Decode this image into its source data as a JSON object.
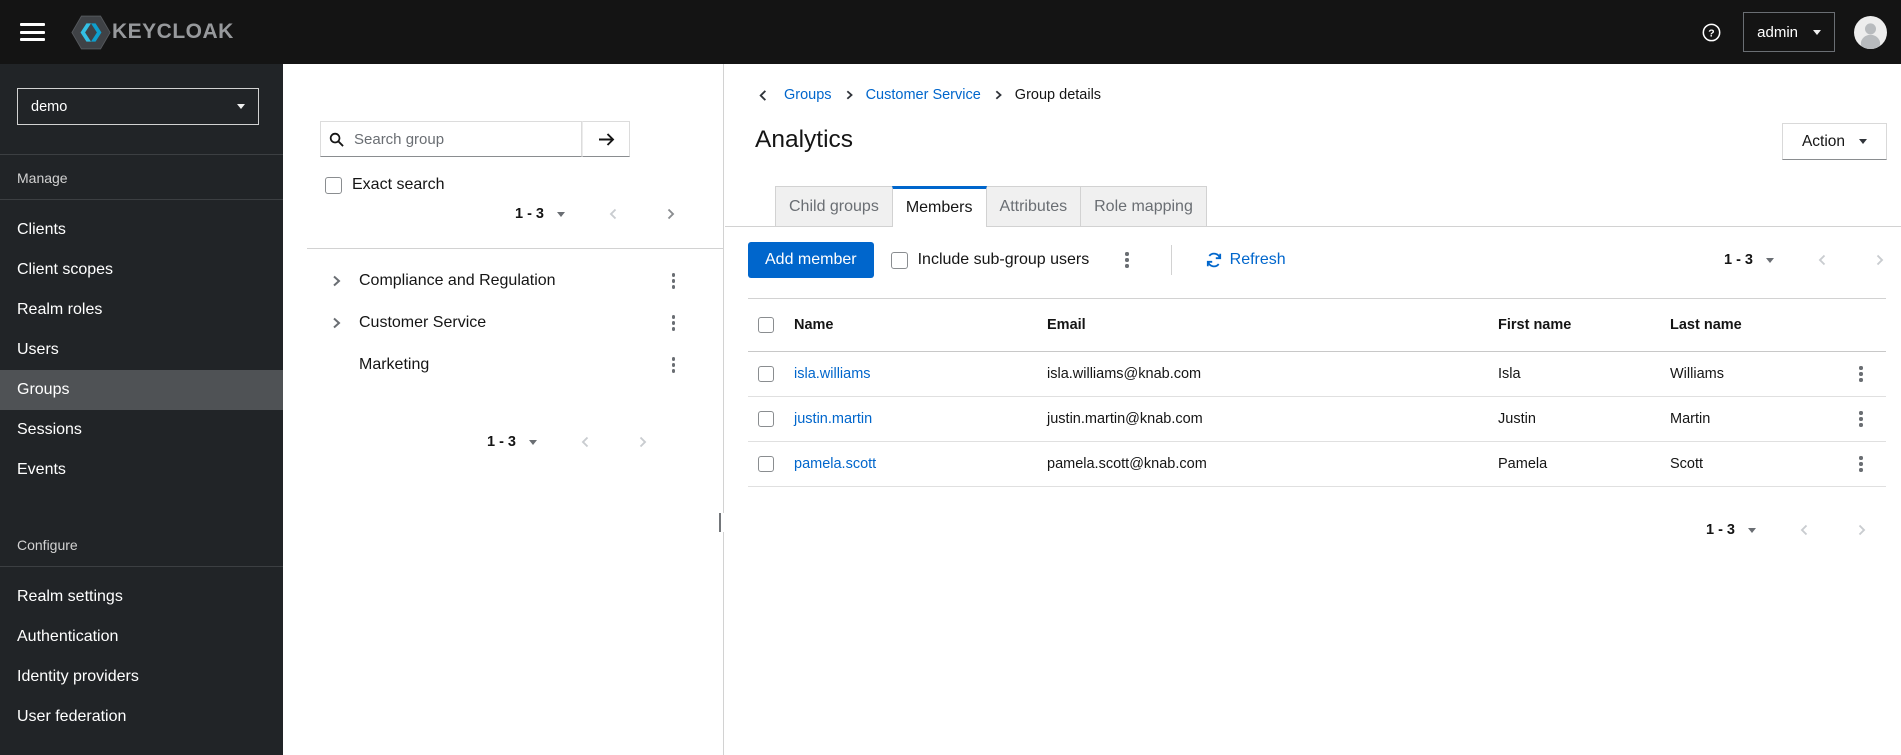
{
  "masthead": {
    "brand": "KEYCLOAK",
    "user": "admin"
  },
  "sidebar": {
    "realm": "demo",
    "sections": [
      {
        "label": "Manage",
        "items": [
          "Clients",
          "Client scopes",
          "Realm roles",
          "Users",
          "Groups",
          "Sessions",
          "Events"
        ],
        "selected": "Groups"
      },
      {
        "label": "Configure",
        "items": [
          "Realm settings",
          "Authentication",
          "Identity providers",
          "User federation"
        ]
      }
    ]
  },
  "tree": {
    "search_placeholder": "Search group",
    "exact_search": "Exact search",
    "pagination_top": "1 - 3",
    "pagination_bottom": "1 - 3",
    "groups": [
      {
        "name": "Compliance and Regulation",
        "expandable": true
      },
      {
        "name": "Customer Service",
        "expandable": true
      },
      {
        "name": "Marketing",
        "expandable": false
      }
    ]
  },
  "main": {
    "breadcrumb": {
      "items": [
        "Groups",
        "Customer Service",
        "Group details"
      ]
    },
    "title": "Analytics",
    "action_label": "Action",
    "tabs": [
      {
        "label": "Child groups",
        "active": false
      },
      {
        "label": "Members",
        "active": true
      },
      {
        "label": "Attributes",
        "active": false
      },
      {
        "label": "Role mapping",
        "active": false
      }
    ],
    "toolbar": {
      "add_member": "Add member",
      "include_subgroups": "Include sub-group users",
      "refresh": "Refresh",
      "pagination": "1 - 3"
    },
    "table": {
      "columns": [
        "Name",
        "Email",
        "First name",
        "Last name"
      ],
      "rows": [
        {
          "name": "isla.williams",
          "email": "isla.williams@knab.com",
          "first": "Isla",
          "last": "Williams"
        },
        {
          "name": "justin.martin",
          "email": "justin.martin@knab.com",
          "first": "Justin",
          "last": "Martin"
        },
        {
          "name": "pamela.scott",
          "email": "pamela.scott@knab.com",
          "first": "Pamela",
          "last": "Scott"
        }
      ]
    },
    "pagination_bottom": "1 - 3"
  },
  "colors": {
    "accent": "#0066cc",
    "masthead_bg": "#141414",
    "sidebar_bg": "#212427",
    "selected_nav_bg": "#4f5255"
  }
}
